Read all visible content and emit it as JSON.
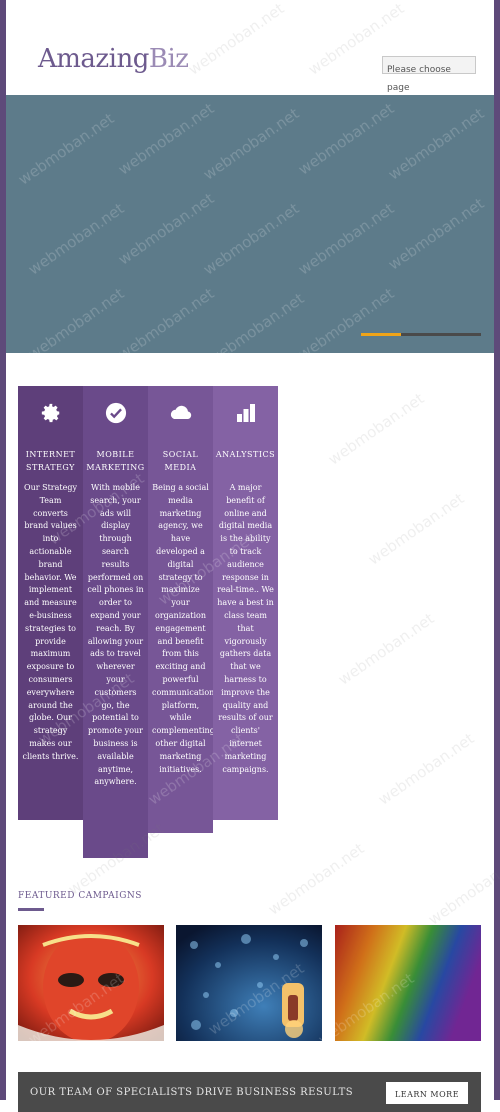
{
  "header": {
    "logo_main": "Amazing",
    "logo_sub": "Biz",
    "page_select_placeholder": "Please choose page"
  },
  "banner": {
    "bg_color": "#5d7b8a",
    "slider_colors": [
      "#f0a418",
      "#4a4a4a"
    ]
  },
  "features": [
    {
      "icon": "gear-icon",
      "title": "INTERNET STRATEGY",
      "text": "Our Strategy Team converts brand values into actionable brand behavior. We implement and measure e-business strategies to provide maximum exposure to consumers everywhere around the globe. Our strategy makes our clients thrive.",
      "color": "#5e3f7a"
    },
    {
      "icon": "check-circle-icon",
      "title": "MOBILE MARKETING",
      "text": "With mobile search, your ads will display through search results performed on cell phones in order to expand your reach. By allowing your ads to travel wherever your customers go, the potential to promote your business is available anytime, anywhere.",
      "color": "#6a4a8a"
    },
    {
      "icon": "cloud-icon",
      "title": "SOCIAL MEDIA",
      "text": "Being a social media marketing agency, we have developed a digital strategy to maximize your organization engagement and benefit from this exciting and powerful communication platform, while complementing other digital marketing initiatives.",
      "color": "#775697"
    },
    {
      "icon": "bar-chart-icon",
      "title": "ANALYSTICS",
      "text": "A major benefit of online and digital media is the ability to track audience response in real-time.. We have a best in class team that vigorously gathers data that we harness to improve the quality and results of our clients' internet marketing campaigns.",
      "color": "#8462a4"
    }
  ],
  "featured": {
    "title": "FEATURED CAMPAIGNS"
  },
  "cta": {
    "text": "OUR TEAM OF SPECIALISTS DRIVE BUSINESS RESULTS",
    "button": "LEARN MORE"
  },
  "watermark": "webmoban.net"
}
